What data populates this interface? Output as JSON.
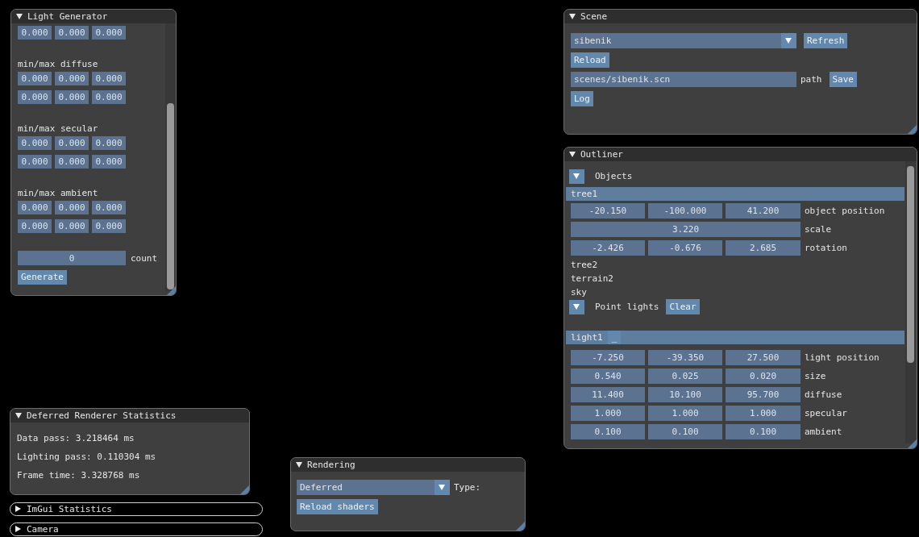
{
  "light_generator": {
    "title": "Light Generator",
    "expanded": true,
    "top_row": [
      "0.000",
      "0.000",
      "0.000"
    ],
    "groups": [
      {
        "label": "min/max diffuse",
        "rows": [
          [
            "0.000",
            "0.000",
            "0.000"
          ],
          [
            "0.000",
            "0.000",
            "0.000"
          ]
        ]
      },
      {
        "label": "min/max secular",
        "rows": [
          [
            "0.000",
            "0.000",
            "0.000"
          ],
          [
            "0.000",
            "0.000",
            "0.000"
          ]
        ]
      },
      {
        "label": "min/max ambient",
        "rows": [
          [
            "0.000",
            "0.000",
            "0.000"
          ],
          [
            "0.000",
            "0.000",
            "0.000"
          ]
        ]
      }
    ],
    "count": {
      "value": "0",
      "label": "count"
    },
    "button": "Generate"
  },
  "scene": {
    "title": "Scene",
    "expanded": true,
    "combo": "sibenik",
    "refresh": "Refresh",
    "reload": "Reload",
    "path": {
      "value": "scenes/sibenik.scn",
      "label": "path"
    },
    "save": "Save",
    "log": "Log"
  },
  "outliner": {
    "title": "Outliner",
    "expanded": true,
    "objects": {
      "label": "Objects",
      "expanded": true,
      "items": [
        {
          "name": "tree1",
          "selected": true,
          "properties": [
            {
              "values": [
                "-20.150",
                "-100.000",
                "41.200"
              ],
              "label": "object position"
            },
            {
              "values": [
                "3.220"
              ],
              "label": "scale"
            },
            {
              "values": [
                "-2.426",
                "-0.676",
                "2.685"
              ],
              "label": "rotation"
            }
          ]
        },
        {
          "name": "tree2",
          "selected": false
        },
        {
          "name": "terrain2",
          "selected": false
        },
        {
          "name": "sky",
          "selected": false
        }
      ]
    },
    "lights": {
      "label": "Point lights",
      "expanded": true,
      "clear": "Clear",
      "items": [
        {
          "name": "light1",
          "selected": true,
          "remove": "_",
          "properties": [
            {
              "values": [
                "-7.250",
                "-39.350",
                "27.500"
              ],
              "label": "light position"
            },
            {
              "values": [
                "0.540",
                "0.025",
                "0.020"
              ],
              "label": "size"
            },
            {
              "values": [
                "11.400",
                "10.100",
                "95.700"
              ],
              "label": "diffuse"
            },
            {
              "values": [
                "1.000",
                "1.000",
                "1.000"
              ],
              "label": "specular"
            },
            {
              "values": [
                "0.100",
                "0.100",
                "0.100"
              ],
              "label": "ambient"
            }
          ]
        }
      ]
    }
  },
  "stats": {
    "title": "Deferred Renderer Statistics",
    "expanded": true,
    "lines": [
      "Data pass: 3.218464 ms",
      "Lighting pass: 0.110304 ms",
      "Frame time: 3.328768 ms"
    ]
  },
  "collapsed_windows": [
    {
      "title": "ImGui Statistics",
      "expanded": false
    },
    {
      "title": "Camera",
      "expanded": false
    }
  ],
  "rendering": {
    "title": "Rendering",
    "expanded": true,
    "combo": "Deferred",
    "label": "Type:",
    "button": "Reload shaders"
  }
}
